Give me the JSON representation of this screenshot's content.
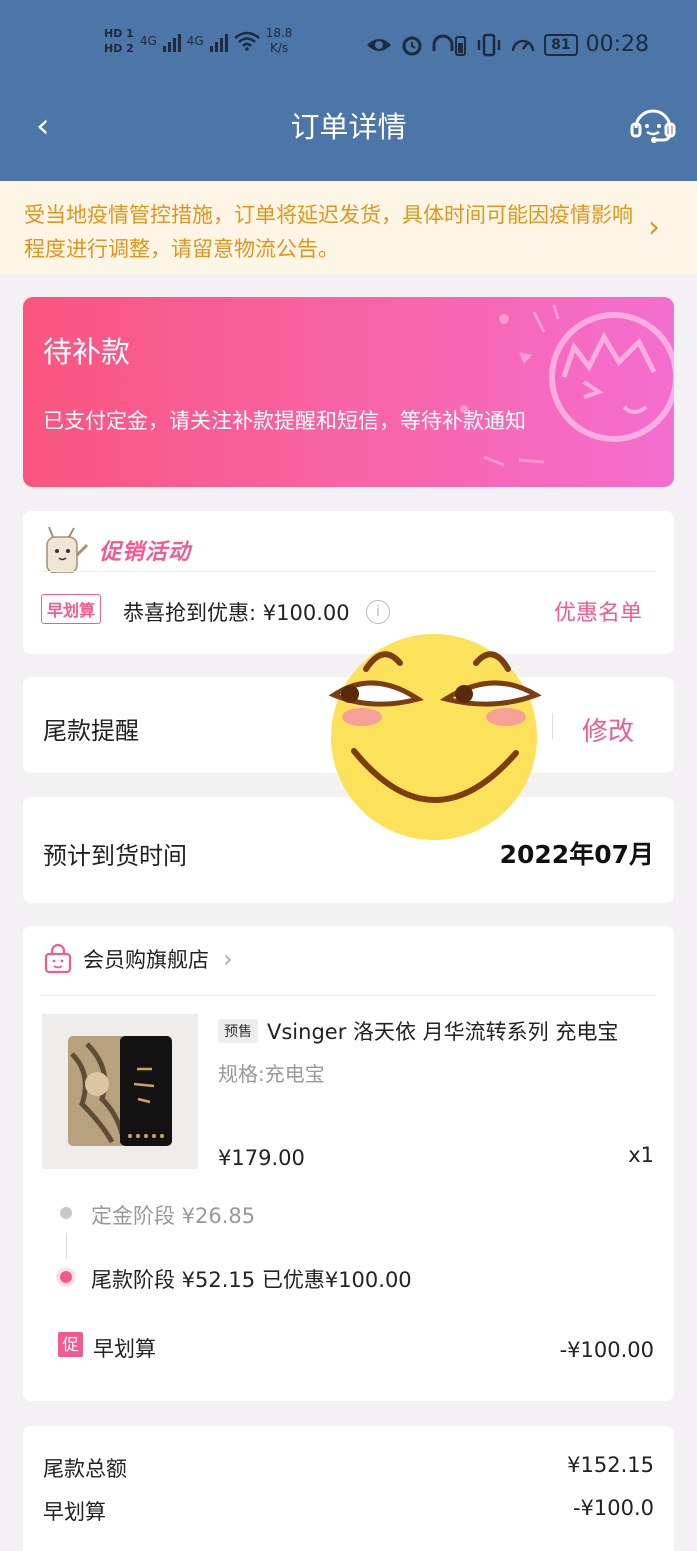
{
  "status_bar": {
    "hd1": "HD 1",
    "hd2": "HD 2",
    "net1": "4G",
    "net2": "4G",
    "speed_value": "18.8",
    "speed_unit": "K/s",
    "battery": "81",
    "time": "00:28"
  },
  "header": {
    "back_icon": "chevron-left-icon",
    "title": "订单详情",
    "service_icon": "customer-service-icon"
  },
  "notice": {
    "text": "受当地疫情管控措施，订单将延迟发货，具体时间可能因疫情影响程度进行调整，请留意物流公告。",
    "arrow": "›"
  },
  "order_status": {
    "title": "待补款",
    "description": "已支付定金，请关注补款提醒和短信，等待补款通知"
  },
  "promotion": {
    "title": "促销活动",
    "tag": "早划算",
    "text": "恭喜抢到优惠: ¥100.00",
    "info_icon": "i",
    "link": "优惠名单"
  },
  "reminder": {
    "label": "尾款提醒",
    "action": "修改"
  },
  "eta": {
    "label": "预计到货时间",
    "value": "2022年07月"
  },
  "shop": {
    "name": "会员购旗舰店",
    "chevron": "›"
  },
  "product": {
    "presale_tag": "预售",
    "name": "Vsinger 洛天依 月华流转系列 充电宝",
    "spec": "规格:充电宝",
    "price": "¥179.00",
    "qty": "x1"
  },
  "stages": {
    "deposit": "定金阶段  ¥26.85",
    "final": "尾款阶段  ¥52.15  已优惠¥100.00"
  },
  "discount": {
    "badge": "促",
    "name": "早划算",
    "amount": "-¥100.00"
  },
  "totals": {
    "final_label": "尾款总额",
    "final_value": "¥152.15",
    "early_label": "早划算",
    "early_value": "-¥100.0"
  },
  "colors": {
    "header": "#4c75a8",
    "accent": "#f15b8f",
    "notice": "#e0951c"
  }
}
